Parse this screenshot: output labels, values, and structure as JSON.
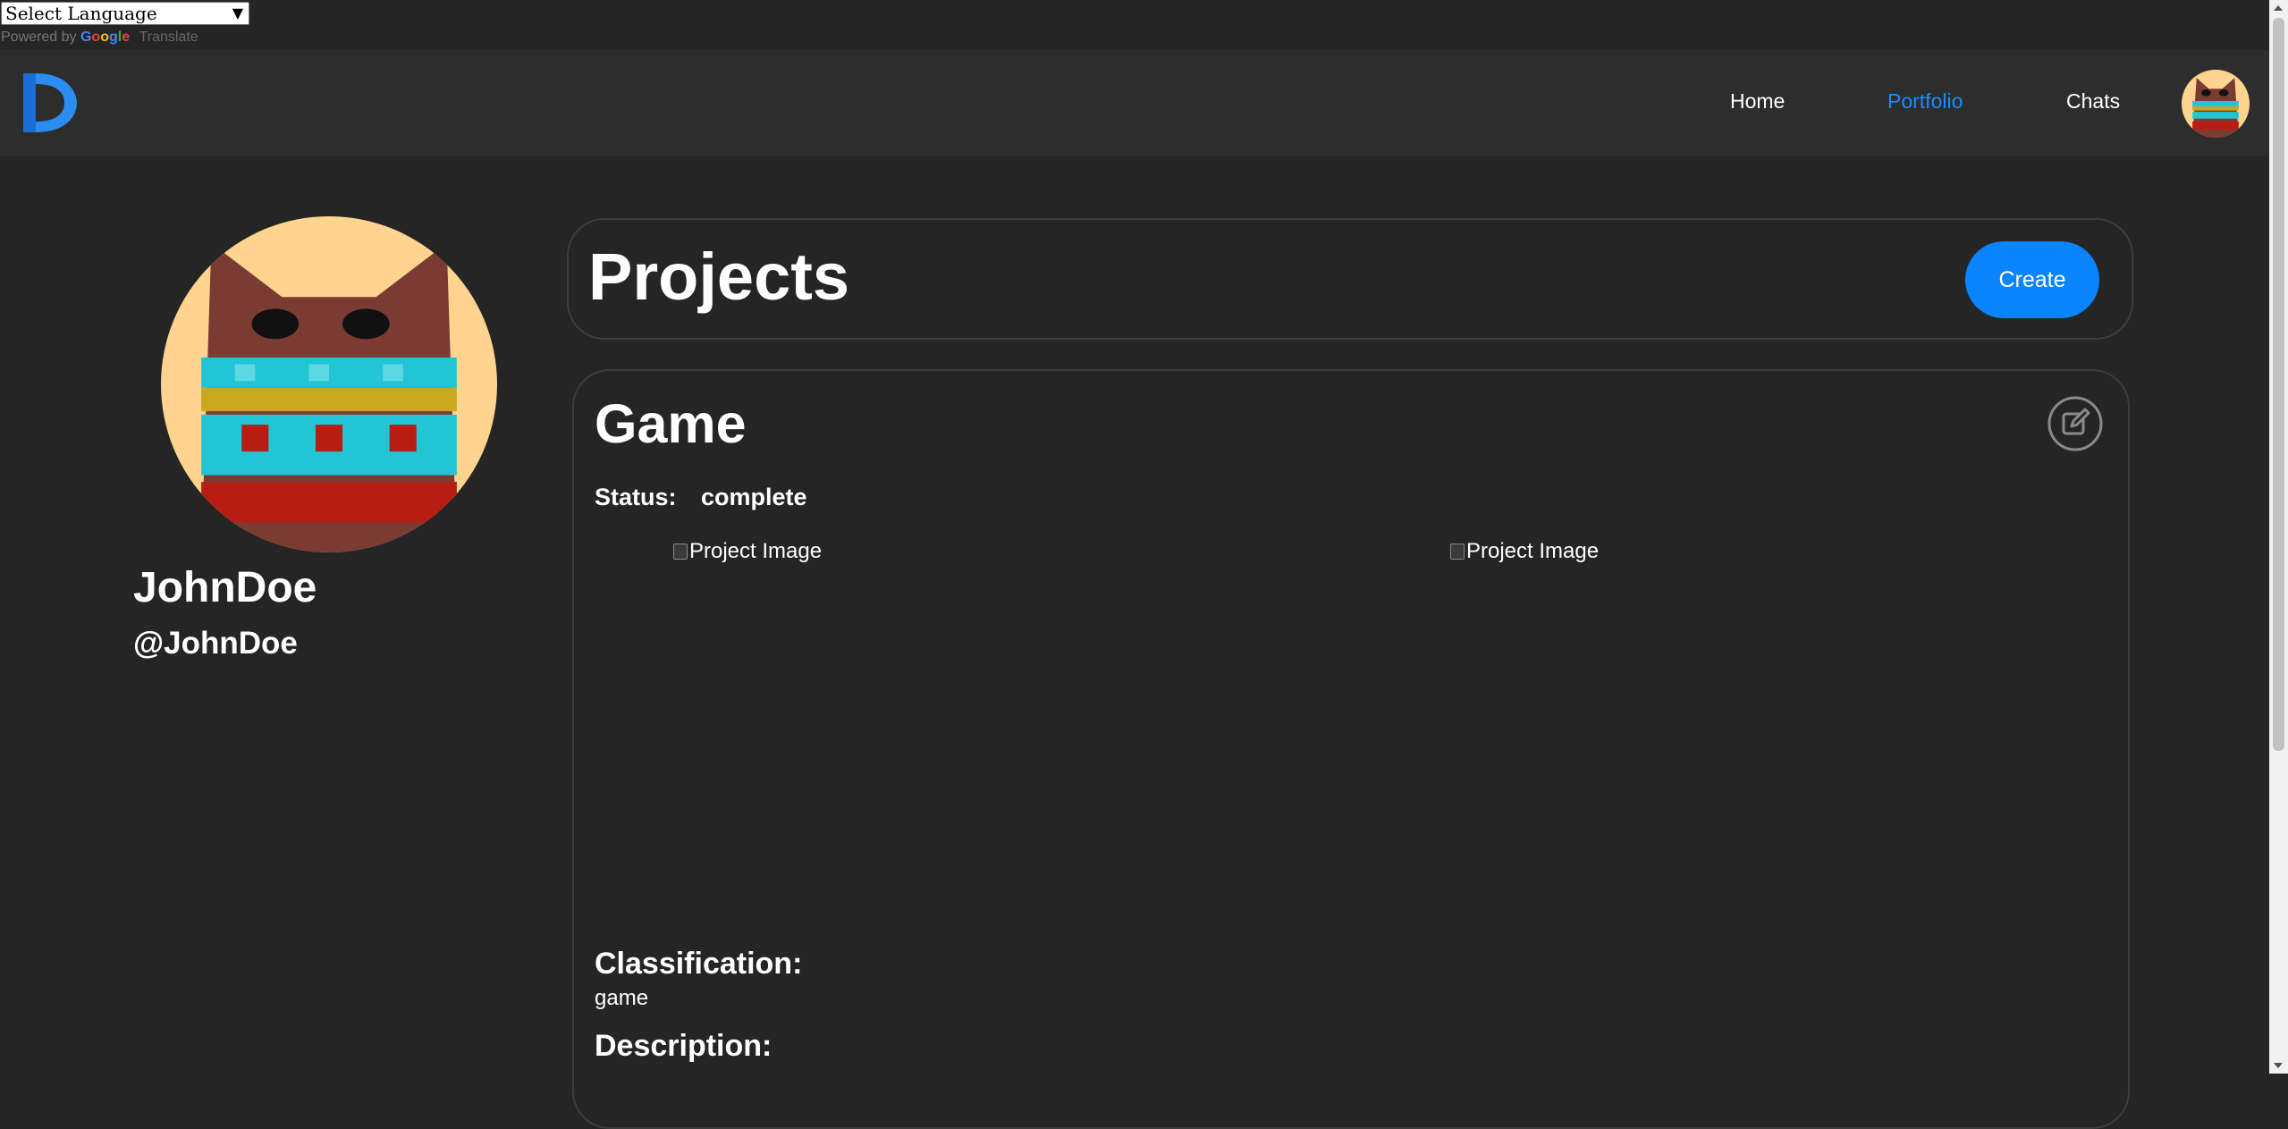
{
  "translate": {
    "select_label": "Select Language",
    "powered_by": "Powered by",
    "google": "Google",
    "translate": "Translate"
  },
  "nav": {
    "links": [
      {
        "label": "Home",
        "active": false
      },
      {
        "label": "Portfolio",
        "active": true
      },
      {
        "label": "Chats",
        "active": false
      }
    ],
    "accent_color": "#1a8cff"
  },
  "profile": {
    "display_name": "JohnDoe",
    "handle": "@JohnDoe"
  },
  "projects": {
    "title": "Projects",
    "create_label": "Create"
  },
  "project": {
    "title": "Game",
    "status_label": "Status:",
    "status_value": "complete",
    "images": [
      {
        "alt": "Project Image"
      },
      {
        "alt": "Project Image"
      }
    ],
    "classification_label": "Classification:",
    "classification_value": "game",
    "description_label": "Description:"
  },
  "colors": {
    "background": "#252525",
    "navbar": "#2d2d2d",
    "button": "#0a84ff"
  },
  "icons": [
    "logo-icon",
    "edit-icon",
    "broken-image-icon",
    "dropdown-arrow-icon"
  ]
}
